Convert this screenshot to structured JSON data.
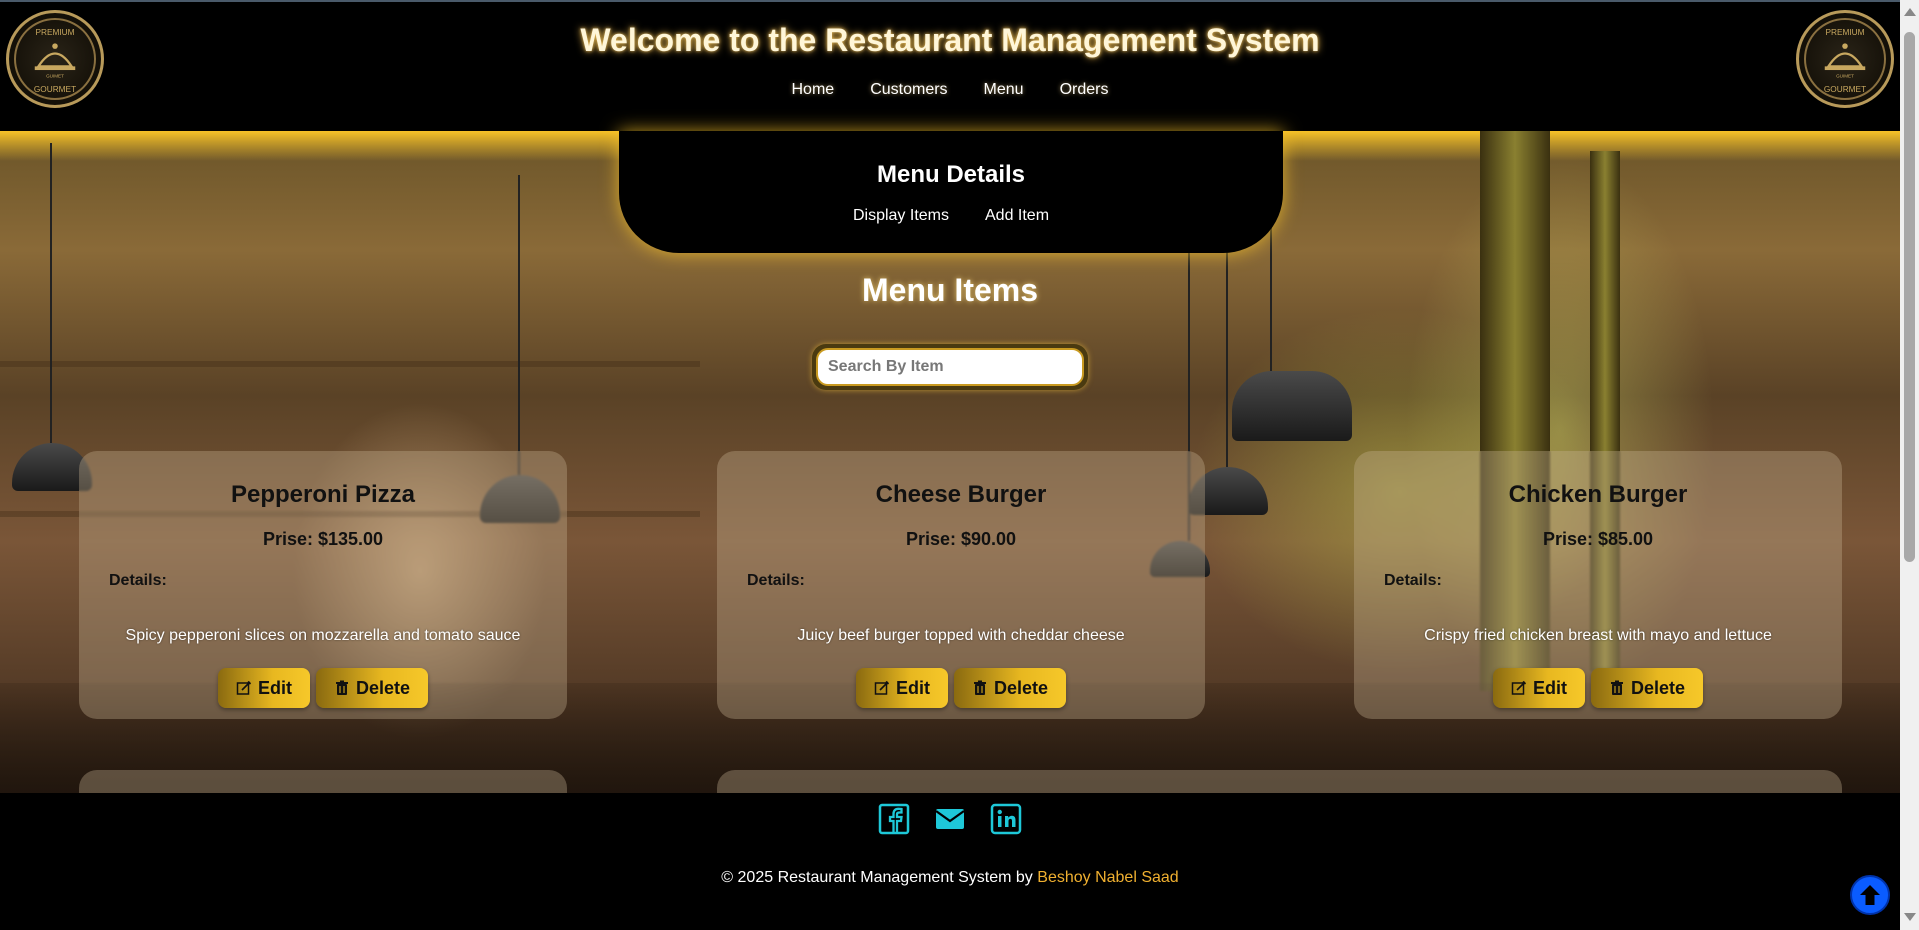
{
  "header": {
    "title": "Welcome to the Restaurant Management System",
    "logo_text_top": "PREMIUM",
    "logo_text_bottom": "GOURMET",
    "logo_text_mid": "GUIMET",
    "nav": [
      {
        "label": "Home"
      },
      {
        "label": "Customers"
      },
      {
        "label": "Menu"
      },
      {
        "label": "Orders"
      }
    ]
  },
  "sub_panel": {
    "title": "Menu Details",
    "nav": [
      {
        "label": "Display Items"
      },
      {
        "label": "Add Item"
      }
    ]
  },
  "main": {
    "heading": "Menu Items",
    "search": {
      "placeholder": "Search By Item",
      "value": ""
    },
    "items": [
      {
        "name": "Pepperoni Pizza",
        "price": "Prise: $135.00",
        "details_label": "Details:",
        "description": "Spicy pepperoni slices on mozzarella and tomato sauce",
        "edit_label": "Edit",
        "delete_label": "Delete"
      },
      {
        "name": "Cheese Burger",
        "price": "Prise: $90.00",
        "details_label": "Details:",
        "description": "Juicy beef burger topped with cheddar cheese",
        "edit_label": "Edit",
        "delete_label": "Delete"
      },
      {
        "name": "Chicken Burger",
        "price": "Prise: $85.00",
        "details_label": "Details:",
        "description": "Crispy fried chicken breast with mayo and lettuce",
        "edit_label": "Edit",
        "delete_label": "Delete"
      }
    ]
  },
  "footer": {
    "social": [
      {
        "icon": "facebook-icon",
        "color": "#1ec8d8"
      },
      {
        "icon": "mail-icon",
        "color": "#1ec8d8"
      },
      {
        "icon": "linkedin-icon",
        "color": "#1ec8d8"
      }
    ],
    "copyright_prefix": "© 2025 Restaurant Management System by",
    "author": "Beshoy Nabel Saad"
  },
  "colors": {
    "accent_gold": "#e8b820",
    "author_link": "#f0b030",
    "back_to_top": "#0a5cff",
    "social_icon": "#1ec8d8"
  }
}
